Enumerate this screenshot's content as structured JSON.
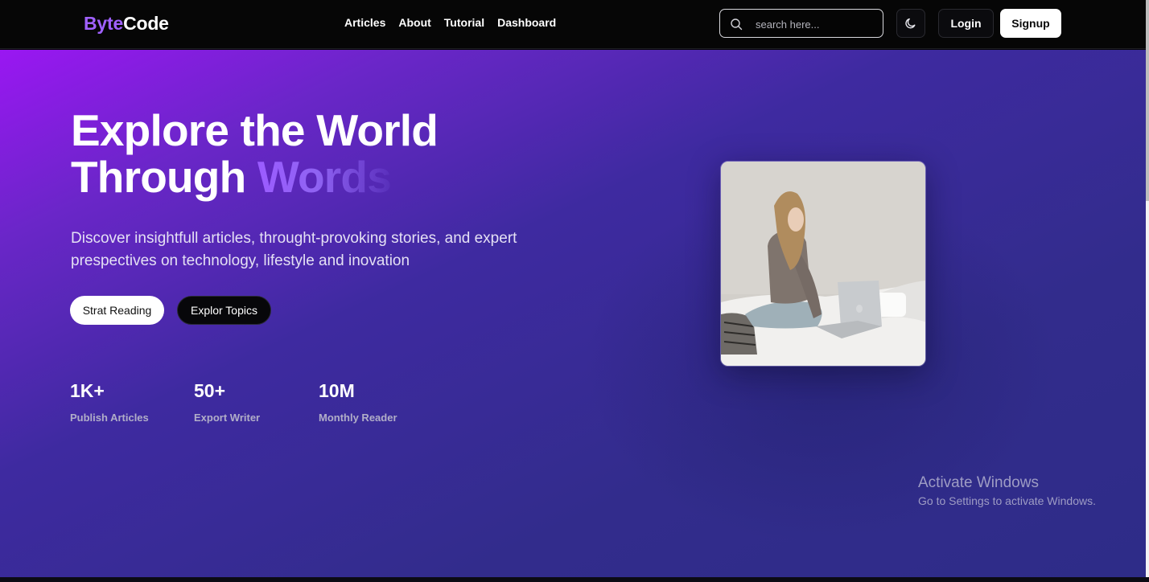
{
  "brand": {
    "part1": "Byte",
    "part2": "Code"
  },
  "nav": {
    "links": [
      "Articles",
      "About",
      "Tutorial",
      "Dashboard"
    ]
  },
  "search": {
    "placeholder": "search here...",
    "value": ""
  },
  "auth": {
    "login_label": "Login",
    "signup_label": "Signup"
  },
  "icons": {
    "search": "search-icon",
    "theme": "moon-icon"
  },
  "hero": {
    "title_line1": "Explore the World",
    "title_line2_plain": "Through ",
    "title_line2_accent": "Words",
    "subtitle": "Discover insightfull articles, throught-provoking stories, and expert prespectives on technology, lifestyle and inovation",
    "primary_cta": "Strat Reading",
    "secondary_cta": "Explor Topics",
    "stats": [
      {
        "value": "1K+",
        "label": "Publish Articles"
      },
      {
        "value": "50+",
        "label": "Export Writer"
      },
      {
        "value": "10M",
        "label": "Monthly Reader"
      }
    ]
  },
  "os_overlay": {
    "title": "Activate Windows",
    "message": "Go to Settings to activate Windows."
  },
  "colors": {
    "brand_accent": "#a061ff",
    "hero_gradient_start": "#9a17f2",
    "hero_gradient_end": "#2e2c88",
    "navbar_bg": "#060606"
  }
}
